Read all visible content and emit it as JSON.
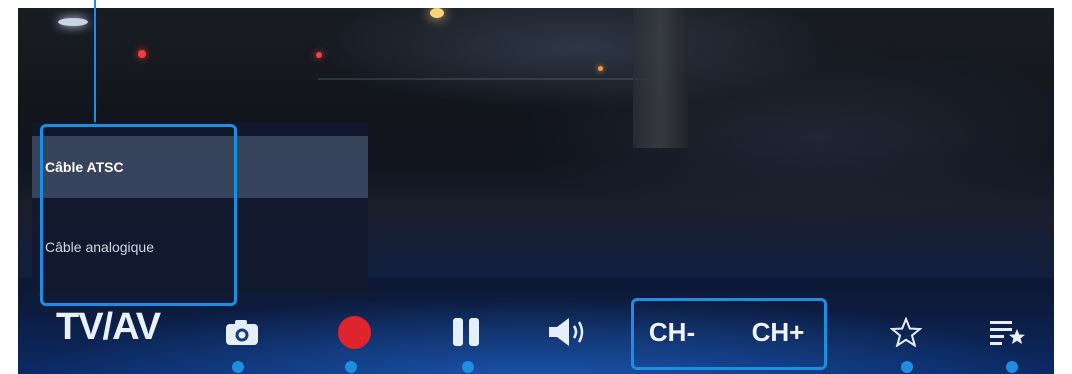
{
  "menu": {
    "items": [
      {
        "label": "Câble ATSC",
        "selected": true
      },
      {
        "label": "Câble analogique",
        "selected": false
      }
    ]
  },
  "toolbar": {
    "source_label": "TV/AV",
    "channel_down_label": "CH-",
    "channel_up_label": "CH+",
    "icons": [
      "camera-icon",
      "record-icon",
      "pause-icon",
      "volume-icon",
      "star-icon",
      "playlist-star-icon"
    ]
  },
  "colors": {
    "highlight": "#1e8fe0",
    "record": "#e0242b"
  }
}
